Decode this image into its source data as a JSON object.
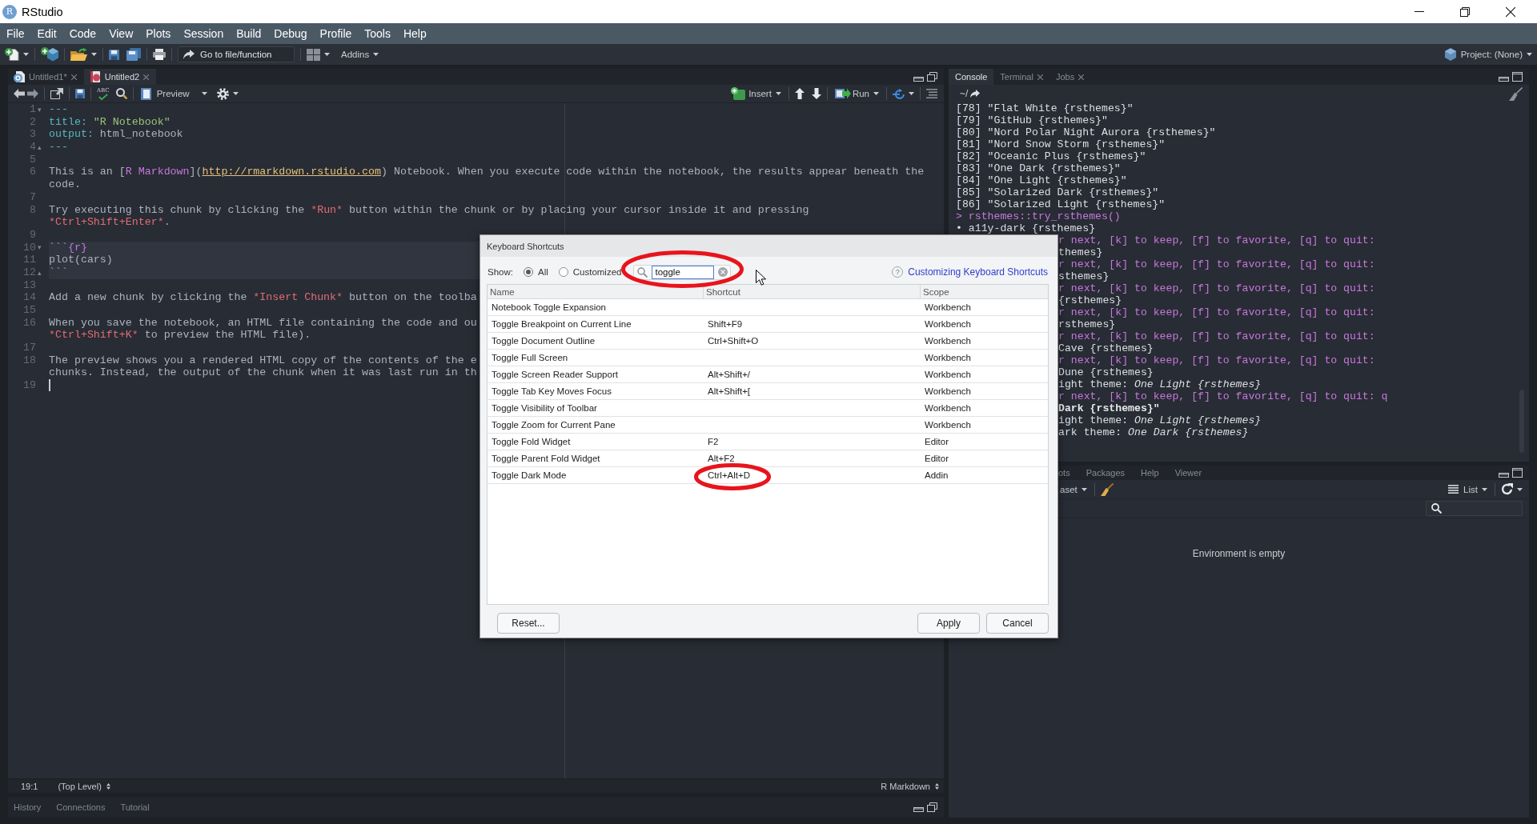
{
  "window": {
    "logo": "R",
    "title": "RStudio"
  },
  "menu": [
    "File",
    "Edit",
    "Code",
    "View",
    "Plots",
    "Session",
    "Build",
    "Debug",
    "Profile",
    "Tools",
    "Help"
  ],
  "toolbar": {
    "goto": {
      "placeholder": "Go to file/function"
    },
    "addins": "Addins",
    "project": "Project: (None)"
  },
  "editor": {
    "tabs": [
      {
        "label": "Untitled1*",
        "kind": "script",
        "selected": false
      },
      {
        "label": "Untitled2",
        "kind": "notebook",
        "selected": true
      }
    ],
    "toolbar": {
      "spellcheck": "ABC",
      "preview": "Preview",
      "insert": "Insert",
      "run": "Run"
    },
    "lines": [
      {
        "number": "1",
        "fold": "▾",
        "segments": [
          {
            "text": "---",
            "kind": "yaml"
          }
        ],
        "chunk": false,
        "cursor": false
      },
      {
        "number": "2",
        "segments": [
          {
            "text": "title: ",
            "kind": "yaml"
          },
          {
            "text": "\"R Notebook\"",
            "kind": "string"
          }
        ],
        "chunk": false,
        "cursor": false
      },
      {
        "number": "3",
        "segments": [
          {
            "text": "output: ",
            "kind": "yaml"
          },
          {
            "text": "html_notebook",
            "kind": "plain"
          }
        ],
        "chunk": false,
        "cursor": false
      },
      {
        "number": "4",
        "fold": "▴",
        "segments": [
          {
            "text": "---",
            "kind": "yaml"
          }
        ],
        "chunk": false,
        "cursor": false
      },
      {
        "number": "5",
        "chunk": false,
        "cursor": false
      },
      {
        "number": "6",
        "segments": [
          {
            "text": "This is an [",
            "kind": "plain"
          },
          {
            "text": "R Markdown",
            "kind": "link"
          },
          {
            "text": "](",
            "kind": "plain"
          },
          {
            "text": "http://rmarkdown.rstudio.com",
            "kind": "url"
          },
          {
            "text": ") Notebook. When you execute code within the notebook, the results appear beneath the",
            "kind": "plain"
          }
        ],
        "chunk": false,
        "cursor": false
      },
      {
        "segments": [
          {
            "text": "code.",
            "kind": "plain"
          }
        ],
        "chunk": false,
        "cursor": false
      },
      {
        "number": "7",
        "chunk": false,
        "cursor": false
      },
      {
        "number": "8",
        "segments": [
          {
            "text": "Try executing this chunk by clicking the ",
            "kind": "plain"
          },
          {
            "text": "*Run*",
            "kind": "emph"
          },
          {
            "text": " button within the chunk or by placing your cursor inside it and pressing",
            "kind": "plain"
          }
        ],
        "chunk": false,
        "cursor": false
      },
      {
        "segments": [
          {
            "text": "*Ctrl+Shift+Enter*",
            "kind": "emph"
          },
          {
            "text": ".",
            "kind": "plain"
          }
        ],
        "chunk": false,
        "cursor": false
      },
      {
        "number": "9",
        "chunk": false,
        "cursor": false
      },
      {
        "number": "10",
        "fold": "▾",
        "segments": [
          {
            "text": "```",
            "kind": "plain"
          },
          {
            "text": "{r}",
            "kind": "chunk"
          }
        ],
        "chunk": true,
        "cursor": false
      },
      {
        "number": "11",
        "segments": [
          {
            "text": "plot(cars)",
            "kind": "plain"
          }
        ],
        "chunk": true,
        "cursor": false
      },
      {
        "number": "12",
        "fold": "▴",
        "segments": [
          {
            "text": "```",
            "kind": "plain"
          }
        ],
        "chunk": true,
        "cursor": false
      },
      {
        "number": "13",
        "chunk": false,
        "cursor": false
      },
      {
        "number": "14",
        "segments": [
          {
            "text": "Add a new chunk by clicking the ",
            "kind": "plain"
          },
          {
            "text": "*Insert Chunk*",
            "kind": "emph"
          },
          {
            "text": " button on the toolba",
            "kind": "plain"
          }
        ],
        "chunk": false,
        "cursor": false
      },
      {
        "number": "15",
        "chunk": false,
        "cursor": false
      },
      {
        "number": "16",
        "segments": [
          {
            "text": "When you save the notebook, an HTML file containing the code and ou",
            "kind": "plain"
          }
        ],
        "chunk": false,
        "cursor": false
      },
      {
        "segments": [
          {
            "text": "*Ctrl+Shift+K*",
            "kind": "emph"
          },
          {
            "text": " to preview the HTML file).",
            "kind": "plain"
          }
        ],
        "chunk": false,
        "cursor": false
      },
      {
        "number": "17",
        "chunk": false,
        "cursor": false
      },
      {
        "number": "18",
        "segments": [
          {
            "text": "The preview shows you a rendered HTML copy of the contents of the e",
            "kind": "plain"
          }
        ],
        "chunk": false,
        "cursor": false
      },
      {
        "segments": [
          {
            "text": "chunks. Instead, the output of the chunk when it was last run in th",
            "kind": "plain"
          }
        ],
        "chunk": false,
        "cursor": false
      },
      {
        "number": "19",
        "chunk": false,
        "cursor": true
      }
    ],
    "status": {
      "position": "19:1",
      "scope": "(Top Level)",
      "mode": "R Markdown"
    }
  },
  "history_pane": {
    "tabs": [
      {
        "label": "History",
        "selected": false
      },
      {
        "label": "Connections",
        "selected": false
      },
      {
        "label": "Tutorial",
        "selected": false
      }
    ]
  },
  "console": {
    "tabs": [
      {
        "label": "Console",
        "selected": true,
        "closable": false
      },
      {
        "label": "Terminal",
        "selected": false,
        "closable": true
      },
      {
        "label": "Jobs",
        "selected": false,
        "closable": true
      }
    ],
    "path": "~/",
    "lines": [
      {
        "text": "[78] \"Flat White {rsthemes}\"",
        "kind": "output"
      },
      {
        "text": "[79] \"GitHub {rsthemes}\"",
        "kind": "output"
      },
      {
        "text": "[80] \"Nord Polar Night Aurora {rsthemes}\"",
        "kind": "output"
      },
      {
        "text": "[81] \"Nord Snow Storm {rsthemes}\"",
        "kind": "output"
      },
      {
        "text": "[82] \"Oceanic Plus {rsthemes}\"",
        "kind": "output"
      },
      {
        "text": "[83] \"One Dark {rsthemes}\"",
        "kind": "output"
      },
      {
        "text": "[84] \"One Light {rsthemes}\"",
        "kind": "output"
      },
      {
        "text": "[85] \"Solarized Dark {rsthemes}\"",
        "kind": "output"
      },
      {
        "text": "[86] \"Solarized Light {rsthemes}\"",
        "kind": "output"
      },
      {
        "text": "> rsthemes::try_rsthemes()",
        "kind": "command"
      },
      {
        "text": "• a11y-dark {rsthemes}",
        "kind": "output"
      }
    ],
    "lines_beside_dialog": [
      {
        "text": "r next, [k] to keep, [f] to favorite, [q] to quit:",
        "kind": "prompt"
      },
      {
        "text": "themes}",
        "kind": "output"
      },
      {
        "text": "r next, [k] to keep, [f] to favorite, [q] to quit:",
        "kind": "prompt"
      },
      {
        "text": "sthemes}",
        "kind": "output"
      },
      {
        "text": "r next, [k] to keep, [f] to favorite, [q] to quit:",
        "kind": "prompt"
      },
      {
        "text": "{rsthemes}",
        "kind": "output"
      },
      {
        "text": "r next, [k] to keep, [f] to favorite, [q] to quit:",
        "kind": "prompt"
      },
      {
        "text": "rsthemes}",
        "kind": "output"
      },
      {
        "text": "r next, [k] to keep, [f] to favorite, [q] to quit:",
        "kind": "prompt"
      },
      {
        "text": "Cave {rsthemes}",
        "kind": "output"
      },
      {
        "text": "r next, [k] to keep, [f] to favorite, [q] to quit:",
        "kind": "prompt"
      },
      {
        "text": "Dune {rsthemes}",
        "kind": "output"
      },
      {
        "text": "ight theme: *One Light {rsthemes}*",
        "kind": "output"
      },
      {
        "text": "r next, [k] to keep, [f] to favorite, [q] to quit: q",
        "kind": "prompt"
      },
      {
        "text": "Dark {rsthemes}\"",
        "kind": "bold"
      },
      {
        "text": "ight theme: *One Light {rsthemes}*",
        "kind": "output"
      },
      {
        "text": "ark theme: *One Dark {rsthemes}*",
        "kind": "output"
      }
    ]
  },
  "environment": {
    "tabs": [
      {
        "label": "ots",
        "selected": false
      },
      {
        "label": "Packages",
        "selected": false
      },
      {
        "label": "Help",
        "selected": false
      },
      {
        "label": "Viewer",
        "selected": false
      }
    ],
    "import_label": "aset",
    "view_mode": "List",
    "empty_message": "Environment is empty"
  },
  "dialog": {
    "title": "Keyboard Shortcuts",
    "show_label": "Show:",
    "filters": [
      {
        "label": "All",
        "selected": true
      },
      {
        "label": "Customized",
        "selected": false
      }
    ],
    "search": {
      "value": "toggle",
      "focused": true,
      "highlighted": true
    },
    "help": {
      "icon": "?",
      "link": "Customizing Keyboard Shortcuts"
    },
    "columns": [
      "Name",
      "Shortcut",
      "Scope"
    ],
    "rows": [
      {
        "name": "Notebook Toggle Expansion",
        "scope": "Workbench",
        "highlighted": false
      },
      {
        "name": "Toggle Breakpoint on Current Line",
        "shortcut": "Shift+F9",
        "scope": "Workbench",
        "highlighted": false
      },
      {
        "name": "Toggle Document Outline",
        "shortcut": "Ctrl+Shift+O",
        "scope": "Workbench",
        "highlighted": false
      },
      {
        "name": "Toggle Full Screen",
        "scope": "Workbench",
        "highlighted": false
      },
      {
        "name": "Toggle Screen Reader Support",
        "shortcut": "Alt+Shift+/",
        "scope": "Workbench",
        "highlighted": false
      },
      {
        "name": "Toggle Tab Key Moves Focus",
        "shortcut": "Alt+Shift+[",
        "scope": "Workbench",
        "highlighted": false
      },
      {
        "name": "Toggle Visibility of Toolbar",
        "scope": "Workbench",
        "highlighted": false
      },
      {
        "name": "Toggle Zoom for Current Pane",
        "scope": "Workbench",
        "highlighted": false
      },
      {
        "name": "Toggle Fold Widget",
        "shortcut": "F2",
        "scope": "Editor",
        "highlighted": false
      },
      {
        "name": "Toggle Parent Fold Widget",
        "shortcut": "Alt+F2",
        "scope": "Editor",
        "highlighted": false
      },
      {
        "name": "Toggle Dark Mode",
        "shortcut": "Ctrl+Alt+D",
        "scope": "Addin",
        "highlighted": true
      }
    ],
    "reset": "Reset...",
    "apply": "Apply",
    "cancel": "Cancel"
  }
}
